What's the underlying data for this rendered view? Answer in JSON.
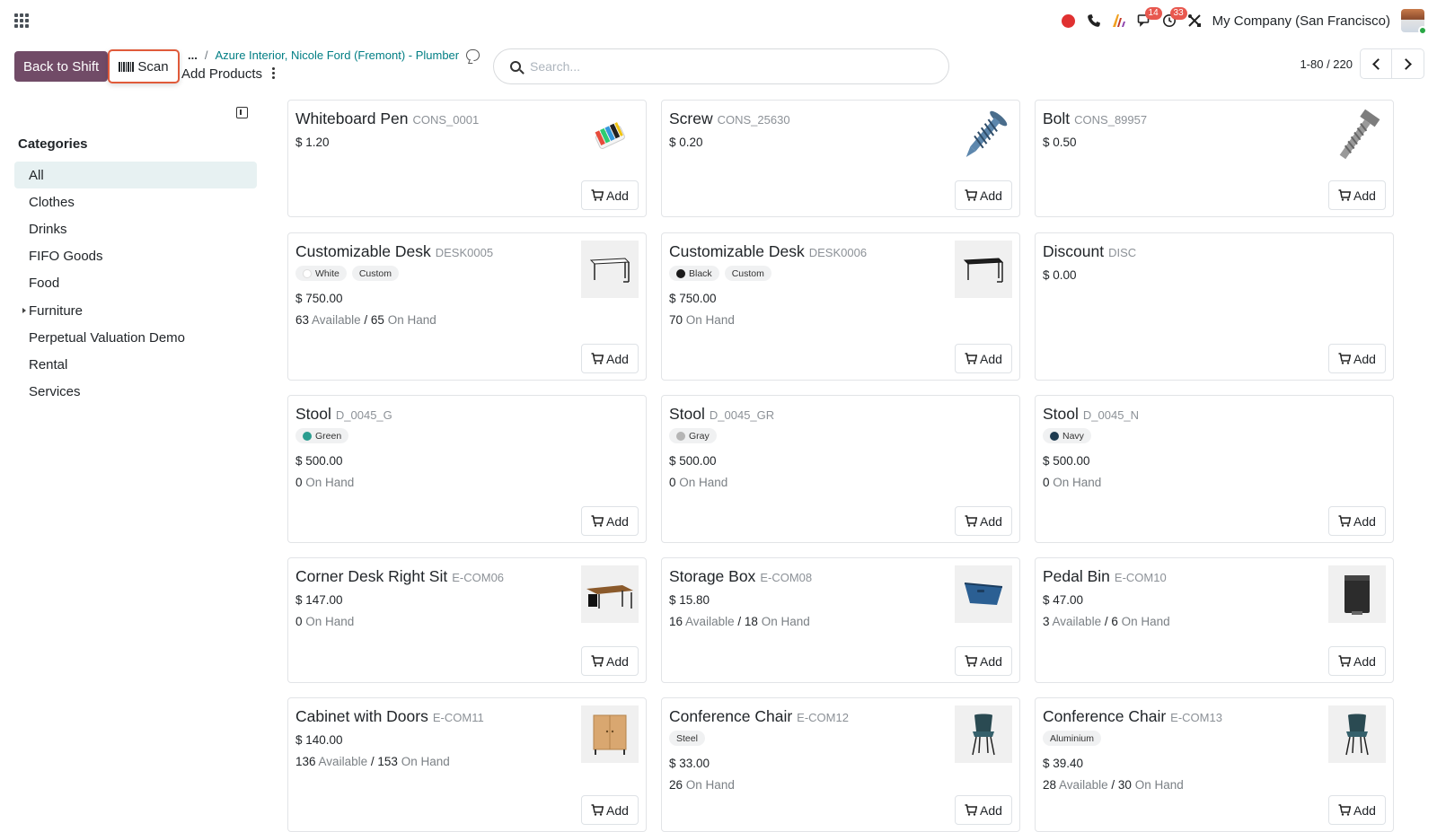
{
  "topbar": {
    "notifications": {
      "messages": "14",
      "activities": "33"
    },
    "company": "My Company (San Francisco)"
  },
  "control": {
    "back_label": "Back to Shift",
    "scan_label": "Scan",
    "breadcrumb_more": "...",
    "breadcrumb_sep": "/",
    "breadcrumb_link": "Azure Interior, Nicole Ford (Fremont) - Plumber",
    "title": "Add Products",
    "search_placeholder": "Search...",
    "pager": "1-80 / 220"
  },
  "sidebar": {
    "title": "Categories",
    "items": [
      {
        "label": "All",
        "active": true
      },
      {
        "label": "Clothes"
      },
      {
        "label": "Drinks"
      },
      {
        "label": "FIFO Goods"
      },
      {
        "label": "Food"
      },
      {
        "label": "Furniture",
        "expandable": true
      },
      {
        "label": "Perpetual Valuation Demo"
      },
      {
        "label": "Rental"
      },
      {
        "label": "Services"
      }
    ]
  },
  "add_label": "Add",
  "products": [
    {
      "name": "Whiteboard Pen",
      "code": "CONS_0001",
      "price": "$ 1.20",
      "icon": "pens-image"
    },
    {
      "name": "Screw",
      "code": "CONS_25630",
      "price": "$ 0.20",
      "icon": "screw-image"
    },
    {
      "name": "Bolt",
      "code": "CONS_89957",
      "price": "$ 0.50",
      "icon": "bolt-image"
    },
    {
      "name": "Customizable Desk",
      "code": "DESK0005",
      "tags": [
        {
          "label": "White",
          "color": "#ffffff"
        },
        {
          "label": "Custom"
        }
      ],
      "price": "$ 750.00",
      "stock": {
        "available": "63",
        "available_label": "Available",
        "sep": "/",
        "onhand": "65",
        "onhand_label": "On Hand"
      },
      "icon": "white-desk-image"
    },
    {
      "name": "Customizable Desk",
      "code": "DESK0006",
      "tags": [
        {
          "label": "Black",
          "color": "#1a1a1a"
        },
        {
          "label": "Custom"
        }
      ],
      "price": "$ 750.00",
      "stock": {
        "onhand": "70",
        "onhand_label": "On Hand"
      },
      "icon": "black-desk-image"
    },
    {
      "name": "Discount",
      "code": "DISC",
      "price": "$ 0.00"
    },
    {
      "name": "Stool",
      "code": "D_0045_G",
      "tags": [
        {
          "label": "Green",
          "color": "#2a9d8f"
        }
      ],
      "price": "$ 500.00",
      "stock": {
        "onhand": "0",
        "onhand_label": "On Hand"
      }
    },
    {
      "name": "Stool",
      "code": "D_0045_GR",
      "tags": [
        {
          "label": "Gray",
          "color": "#b5b5b5"
        }
      ],
      "price": "$ 500.00",
      "stock": {
        "onhand": "0",
        "onhand_label": "On Hand"
      }
    },
    {
      "name": "Stool",
      "code": "D_0045_N",
      "tags": [
        {
          "label": "Navy",
          "color": "#1d3a4f"
        }
      ],
      "price": "$ 500.00",
      "stock": {
        "onhand": "0",
        "onhand_label": "On Hand"
      }
    },
    {
      "name": "Corner Desk Right Sit",
      "code": "E-COM06",
      "price": "$ 147.00",
      "stock": {
        "onhand": "0",
        "onhand_label": "On Hand"
      },
      "icon": "corner-desk-image"
    },
    {
      "name": "Storage Box",
      "code": "E-COM08",
      "price": "$ 15.80",
      "stock": {
        "available": "16",
        "available_label": "Available",
        "sep": "/",
        "onhand": "18",
        "onhand_label": "On Hand"
      },
      "icon": "storage-box-image"
    },
    {
      "name": "Pedal Bin",
      "code": "E-COM10",
      "price": "$ 47.00",
      "stock": {
        "available": "3",
        "available_label": "Available",
        "sep": "/",
        "onhand": "6",
        "onhand_label": "On Hand"
      },
      "icon": "pedal-bin-image"
    },
    {
      "name": "Cabinet with Doors",
      "code": "E-COM11",
      "price": "$ 140.00",
      "stock": {
        "available": "136",
        "available_label": "Available",
        "sep": "/",
        "onhand": "153",
        "onhand_label": "On Hand"
      },
      "icon": "cabinet-image"
    },
    {
      "name": "Conference Chair",
      "code": "E-COM12",
      "tags": [
        {
          "label": "Steel"
        }
      ],
      "price": "$ 33.00",
      "stock": {
        "onhand": "26",
        "onhand_label": "On Hand"
      },
      "icon": "chair-image"
    },
    {
      "name": "Conference Chair",
      "code": "E-COM13",
      "tags": [
        {
          "label": "Aluminium"
        }
      ],
      "price": "$ 39.40",
      "stock": {
        "available": "28",
        "available_label": "Available",
        "sep": "/",
        "onhand": "30",
        "onhand_label": "On Hand"
      },
      "icon": "chair-image"
    }
  ]
}
